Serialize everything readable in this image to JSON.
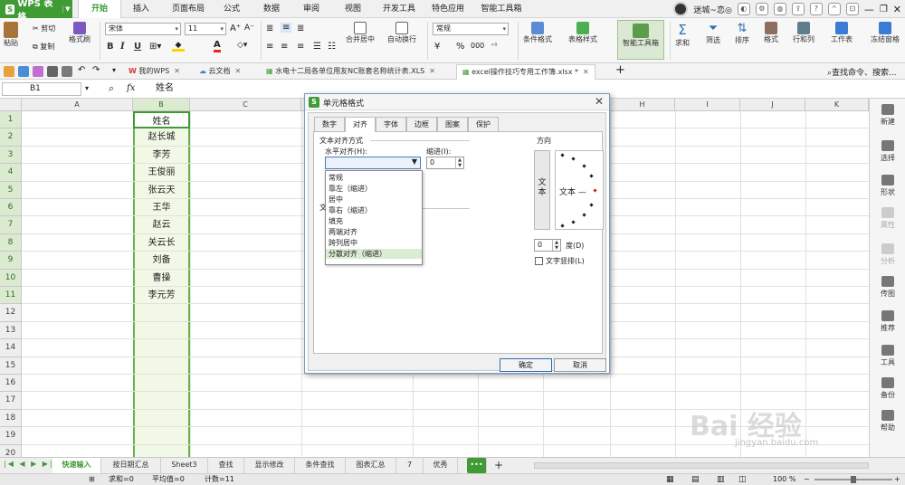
{
  "app": {
    "name": "WPS 表格",
    "logo": "S",
    "menu_tabs": [
      "开始",
      "插入",
      "页面布局",
      "公式",
      "数据",
      "审阅",
      "视图",
      "开发工具",
      "特色应用",
      "智能工具箱"
    ],
    "active_tab": "开始",
    "user_name": "迷城~恋◎"
  },
  "ribbon": {
    "paste": "粘贴",
    "cut": "剪切",
    "copy": "复制",
    "format_painter": "格式刷",
    "font_name": "宋体",
    "font_size": "11",
    "bold": "B",
    "italic": "I",
    "underline": "U",
    "merge_center": "合并居中",
    "wrap": "自动换行",
    "number_format": "常规",
    "currency": "¥",
    "percent": "%",
    "conditional_format": "条件格式",
    "table_style": "表格样式",
    "smart_toolbox": "智能工具箱",
    "sum": "求和",
    "filter": "筛选",
    "sort": "排序",
    "format": "格式",
    "row_col": "行和列",
    "worksheet": "工作表",
    "freeze": "冻结窗格",
    "colors": {
      "accent": "#3f9c35",
      "font_color": "#e02b20",
      "fill_color": "#ffd200"
    }
  },
  "doc_tabs": [
    {
      "label": "我的WPS"
    },
    {
      "label": "云文档"
    },
    {
      "label": "水电十二局各单位用友NC账套名称统计表.XLS"
    },
    {
      "label": "excel操作技巧专用工作簿.xlsx *"
    }
  ],
  "search_commands": "查找命令、搜索...",
  "formula_bar": {
    "cell_ref": "B1",
    "fx": "fx",
    "value": "姓名"
  },
  "grid": {
    "columns": [
      "A",
      "B",
      "C",
      "D",
      "E",
      "F",
      "G",
      "H",
      "I",
      "J",
      "K"
    ],
    "rows": [
      "1",
      "2",
      "3",
      "4",
      "5",
      "6",
      "7",
      "8",
      "9",
      "10",
      "11",
      "12",
      "13",
      "14",
      "15",
      "16",
      "17",
      "18",
      "19",
      "20"
    ],
    "b_values": [
      "姓名",
      "赵长城",
      "李芳",
      "王俊丽",
      "张云天",
      "王华",
      "赵云",
      "关云长",
      "刘备",
      "曹操",
      "李元芳"
    ]
  },
  "right_panel": [
    "新建",
    "选择",
    "形状",
    "属性",
    "分析",
    "传图",
    "推荐",
    "工具",
    "备份",
    "帮助"
  ],
  "sheet_tabs": [
    "快速输入",
    "按日期汇总",
    "Sheet3",
    "查找",
    "显示修改",
    "条件查找",
    "图表汇总",
    "7",
    "优秀"
  ],
  "active_sheet": "快速输入",
  "sheet_more": "•••",
  "sheet_add": "+",
  "status": {
    "sum": "求和=0",
    "avg": "平均值=0",
    "count": "计数=11",
    "zoom": "100 %"
  },
  "dialog": {
    "title": "单元格格式",
    "tabs": [
      "数字",
      "对齐",
      "字体",
      "边框",
      "图案",
      "保护"
    ],
    "active_tab": "对齐",
    "text_align_group": "文本对齐方式",
    "halign_label": "水平对齐(H):",
    "indent_label": "缩进(I):",
    "indent_value": "0",
    "halign_options": [
      "常规",
      "靠左（缩进）",
      "居中",
      "靠右（缩进）",
      "填充",
      "两端对齐",
      "跨列居中",
      "分散对齐（缩进）"
    ],
    "highlighted_option": "分散对齐（缩进）",
    "text_control_partial": "文",
    "orientation_group": "方向",
    "vertical_text": "文本",
    "orient_text": "文本 —",
    "degree_value": "0",
    "degree_label": "度(D)",
    "vertical_wrap_label": "文字竖排(L)",
    "ok": "确定",
    "cancel": "取消"
  },
  "watermark": {
    "logo": "Bai 经验",
    "url": "jingyan.baidu.com"
  }
}
